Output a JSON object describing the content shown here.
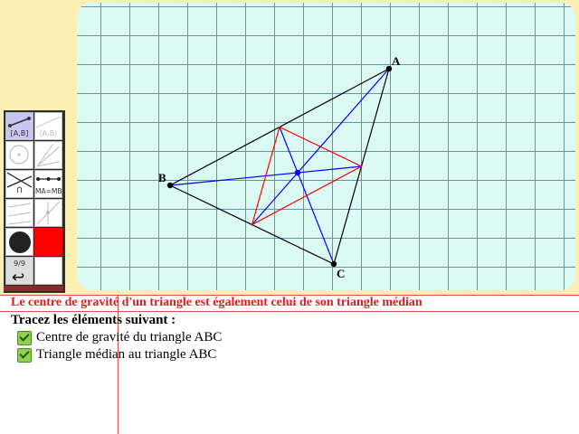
{
  "canvas": {
    "points": [
      {
        "label": "A"
      },
      {
        "label": "B"
      },
      {
        "label": "C"
      }
    ]
  },
  "toolbar": {
    "segment_label": "[A,B]",
    "ray_label": "(A,B)",
    "intersection_label": "∩",
    "equidistant_label": "MA=MB",
    "page_label": "9/9",
    "undo_label": "↩"
  },
  "instructions": {
    "heading": "Le centre de gravité d'un triangle est également celui de son triangle médian",
    "subheading": "Tracez les éléments suivant :",
    "tasks": [
      {
        "label": "Centre de gravité du triangle ABC",
        "done": true
      },
      {
        "label": "Triangle médian au triangle ABC",
        "done": true
      }
    ]
  },
  "colors": {
    "triangle": "#000000",
    "medians": "#0000ff",
    "median_triangle": "#ff0000",
    "heading": "#d42020"
  }
}
